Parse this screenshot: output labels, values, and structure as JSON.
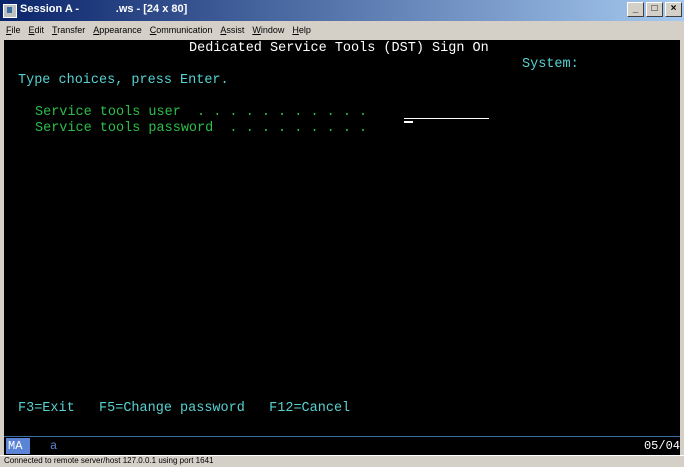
{
  "window": {
    "title": "Session A -            .ws - [24 x 80]",
    "controls": {
      "minimize": "_",
      "maximize": "□",
      "close": "×"
    }
  },
  "menu": [
    "File",
    "Edit",
    "Transfer",
    "Appearance",
    "Communication",
    "Assist",
    "Window",
    "Help"
  ],
  "screen": {
    "heading": "Dedicated Service Tools (DST) Sign On",
    "system_label": "System:",
    "instruction": "Type choices, press Enter.",
    "fields": [
      {
        "label": "Service tools user  . . . . . . . . . . ."
      },
      {
        "label": "Service tools password  . . . . . . . . ."
      }
    ],
    "function_keys": "F3=Exit   F5=Change password   F12=Cancel"
  },
  "oia": {
    "mode": "MA",
    "indicator": "a",
    "cursor_position": "05/04"
  },
  "status": "Connected to remote server/host 127.0.0.1 using port 1641"
}
